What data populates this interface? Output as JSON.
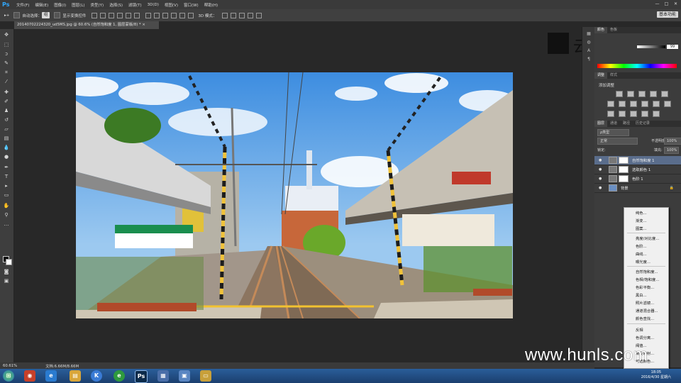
{
  "app": {
    "logo": "Ps"
  },
  "menubar": {
    "items": [
      "文件(F)",
      "编辑(E)",
      "图像(I)",
      "图层(L)",
      "类型(Y)",
      "选择(S)",
      "滤镜(T)",
      "3D(D)",
      "视图(V)",
      "窗口(W)",
      "帮助(H)"
    ]
  },
  "window_controls": {
    "minimize": "—",
    "restore": "□",
    "close": "✕"
  },
  "options": {
    "auto_select_label": "自动选择：",
    "auto_select_value": "组",
    "show_transform_label": "显示变换控件",
    "mode_3d_label": "3D 模式："
  },
  "workspace": {
    "value": "基本功能"
  },
  "document": {
    "tab_title": "20140702224320_ud5MS.jpg @ 60.6% (自然饱和度 1, 图层蒙版/8) *",
    "close": "×"
  },
  "watermark_top": {
    "text": "云课堂"
  },
  "color_panel": {
    "tabs": [
      "颜色",
      "色板"
    ],
    "k_value": "99"
  },
  "adjust_panel": {
    "tabs": [
      "调整",
      "样式"
    ],
    "title": "添加调整"
  },
  "layers_panel": {
    "tabs": [
      "图层",
      "通道",
      "路径",
      "历史记录"
    ],
    "filter_label": "ρ类型",
    "blend_mode": "正常",
    "opacity_label": "不透明度:",
    "opacity_value": "100%",
    "lock_label": "锁定:",
    "fill_label": "填充:",
    "fill_value": "100%",
    "layers": [
      {
        "name": "自然饱和度 1",
        "selected": true
      },
      {
        "name": "选取颜色 1",
        "selected": false
      },
      {
        "name": "色阶 1",
        "selected": false
      },
      {
        "name": "背景",
        "selected": false
      }
    ]
  },
  "context_menu": {
    "items": [
      "纯色...",
      "渐变...",
      "图案...",
      "亮度/对比度...",
      "色阶...",
      "曲线...",
      "曝光度...",
      "自然饱和度...",
      "色相/饱和度...",
      "色彩平衡...",
      "黑白...",
      "照片滤镜...",
      "通道混合器...",
      "颜色查找...",
      "反相",
      "色调分离...",
      "阈值...",
      "渐变映射...",
      "可选颜色..."
    ]
  },
  "status": {
    "zoom": "60.61%",
    "doc_info": "文档:6.66M/8.66M"
  },
  "site_watermark": {
    "text": "www.hunls.com"
  },
  "taskbar": {
    "time": "18:05",
    "date": "2016/4/30 星期六"
  }
}
